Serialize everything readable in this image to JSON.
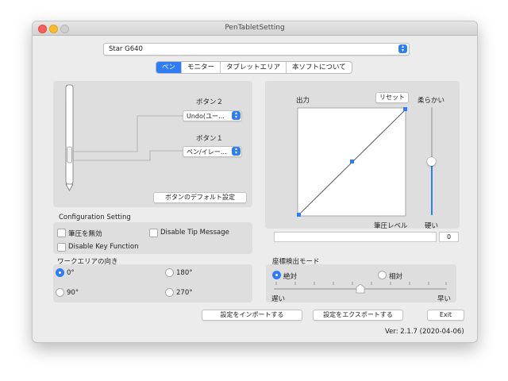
{
  "window": {
    "title": "PenTabletSetting"
  },
  "device_select": {
    "value": "Star G640"
  },
  "tabs": [
    {
      "label": "ペン",
      "active": true
    },
    {
      "label": "モニター",
      "active": false
    },
    {
      "label": "タブレットエリア",
      "active": false
    },
    {
      "label": "本ソフトについて",
      "active": false
    }
  ],
  "pen": {
    "button2_label": "ボタン２",
    "button2_value": "Undo(ユー…",
    "button1_label": "ボタン１",
    "button1_value": "ペン/イレー…",
    "default_button": "ボタンのデフォルト設定"
  },
  "pressure": {
    "output_label": "出力",
    "reset_button": "リセット",
    "soft_label": "柔らかい",
    "hard_label": "硬い",
    "level_label": "筆圧レベル",
    "level_value": "0",
    "slider_level": 0.5
  },
  "config": {
    "title": "Configuration Setting",
    "disable_pressure": "筆圧を無効",
    "disable_tip_message": "Disable Tip Message",
    "disable_key_function": "Disable Key Function"
  },
  "orientation": {
    "title": "ワークエリアの向き",
    "options": [
      "0°",
      "180°",
      "90°",
      "270°"
    ],
    "selected": "0°"
  },
  "coord_mode": {
    "title": "座標検出モード",
    "absolute": "絶対",
    "relative": "相対",
    "selected": "絶対",
    "slow_label": "遅い",
    "fast_label": "早い",
    "speed_level": 0.5
  },
  "footer": {
    "import_button": "設定をインポートする",
    "export_button": "設定をエクスポートする",
    "exit_button": "Exit",
    "version": "Ver: 2.1.7 (2020-04-06)"
  },
  "colors": {
    "accent": "#2e7cf6",
    "close": "#fc5f57",
    "minimize": "#fdbc2e",
    "zoom": "#d0d0d0"
  }
}
